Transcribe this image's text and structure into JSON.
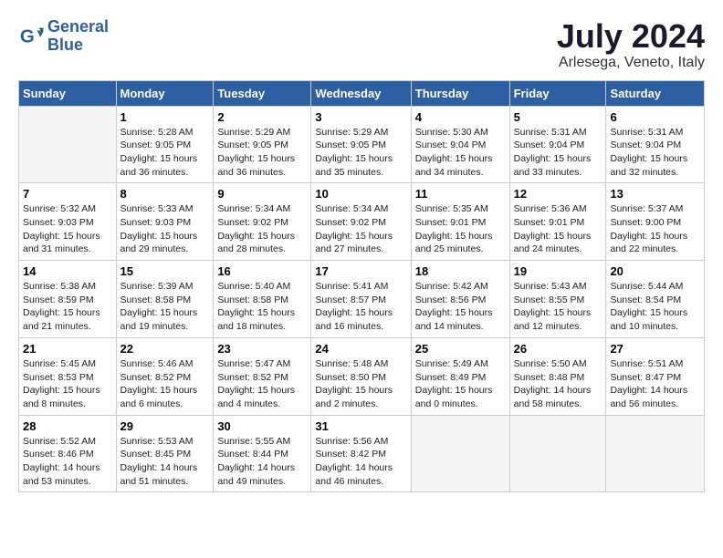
{
  "logo": {
    "text_general": "General",
    "text_blue": "Blue"
  },
  "title": "July 2024",
  "subtitle": "Arlesega, Veneto, Italy",
  "headers": [
    "Sunday",
    "Monday",
    "Tuesday",
    "Wednesday",
    "Thursday",
    "Friday",
    "Saturday"
  ],
  "weeks": [
    [
      {
        "day": "",
        "info": ""
      },
      {
        "day": "1",
        "info": "Sunrise: 5:28 AM\nSunset: 9:05 PM\nDaylight: 15 hours\nand 36 minutes."
      },
      {
        "day": "2",
        "info": "Sunrise: 5:29 AM\nSunset: 9:05 PM\nDaylight: 15 hours\nand 36 minutes."
      },
      {
        "day": "3",
        "info": "Sunrise: 5:29 AM\nSunset: 9:05 PM\nDaylight: 15 hours\nand 35 minutes."
      },
      {
        "day": "4",
        "info": "Sunrise: 5:30 AM\nSunset: 9:04 PM\nDaylight: 15 hours\nand 34 minutes."
      },
      {
        "day": "5",
        "info": "Sunrise: 5:31 AM\nSunset: 9:04 PM\nDaylight: 15 hours\nand 33 minutes."
      },
      {
        "day": "6",
        "info": "Sunrise: 5:31 AM\nSunset: 9:04 PM\nDaylight: 15 hours\nand 32 minutes."
      }
    ],
    [
      {
        "day": "7",
        "info": "Sunrise: 5:32 AM\nSunset: 9:03 PM\nDaylight: 15 hours\nand 31 minutes."
      },
      {
        "day": "8",
        "info": "Sunrise: 5:33 AM\nSunset: 9:03 PM\nDaylight: 15 hours\nand 29 minutes."
      },
      {
        "day": "9",
        "info": "Sunrise: 5:34 AM\nSunset: 9:02 PM\nDaylight: 15 hours\nand 28 minutes."
      },
      {
        "day": "10",
        "info": "Sunrise: 5:34 AM\nSunset: 9:02 PM\nDaylight: 15 hours\nand 27 minutes."
      },
      {
        "day": "11",
        "info": "Sunrise: 5:35 AM\nSunset: 9:01 PM\nDaylight: 15 hours\nand 25 minutes."
      },
      {
        "day": "12",
        "info": "Sunrise: 5:36 AM\nSunset: 9:01 PM\nDaylight: 15 hours\nand 24 minutes."
      },
      {
        "day": "13",
        "info": "Sunrise: 5:37 AM\nSunset: 9:00 PM\nDaylight: 15 hours\nand 22 minutes."
      }
    ],
    [
      {
        "day": "14",
        "info": "Sunrise: 5:38 AM\nSunset: 8:59 PM\nDaylight: 15 hours\nand 21 minutes."
      },
      {
        "day": "15",
        "info": "Sunrise: 5:39 AM\nSunset: 8:58 PM\nDaylight: 15 hours\nand 19 minutes."
      },
      {
        "day": "16",
        "info": "Sunrise: 5:40 AM\nSunset: 8:58 PM\nDaylight: 15 hours\nand 18 minutes."
      },
      {
        "day": "17",
        "info": "Sunrise: 5:41 AM\nSunset: 8:57 PM\nDaylight: 15 hours\nand 16 minutes."
      },
      {
        "day": "18",
        "info": "Sunrise: 5:42 AM\nSunset: 8:56 PM\nDaylight: 15 hours\nand 14 minutes."
      },
      {
        "day": "19",
        "info": "Sunrise: 5:43 AM\nSunset: 8:55 PM\nDaylight: 15 hours\nand 12 minutes."
      },
      {
        "day": "20",
        "info": "Sunrise: 5:44 AM\nSunset: 8:54 PM\nDaylight: 15 hours\nand 10 minutes."
      }
    ],
    [
      {
        "day": "21",
        "info": "Sunrise: 5:45 AM\nSunset: 8:53 PM\nDaylight: 15 hours\nand 8 minutes."
      },
      {
        "day": "22",
        "info": "Sunrise: 5:46 AM\nSunset: 8:52 PM\nDaylight: 15 hours\nand 6 minutes."
      },
      {
        "day": "23",
        "info": "Sunrise: 5:47 AM\nSunset: 8:52 PM\nDaylight: 15 hours\nand 4 minutes."
      },
      {
        "day": "24",
        "info": "Sunrise: 5:48 AM\nSunset: 8:50 PM\nDaylight: 15 hours\nand 2 minutes."
      },
      {
        "day": "25",
        "info": "Sunrise: 5:49 AM\nSunset: 8:49 PM\nDaylight: 15 hours\nand 0 minutes."
      },
      {
        "day": "26",
        "info": "Sunrise: 5:50 AM\nSunset: 8:48 PM\nDaylight: 14 hours\nand 58 minutes."
      },
      {
        "day": "27",
        "info": "Sunrise: 5:51 AM\nSunset: 8:47 PM\nDaylight: 14 hours\nand 56 minutes."
      }
    ],
    [
      {
        "day": "28",
        "info": "Sunrise: 5:52 AM\nSunset: 8:46 PM\nDaylight: 14 hours\nand 53 minutes."
      },
      {
        "day": "29",
        "info": "Sunrise: 5:53 AM\nSunset: 8:45 PM\nDaylight: 14 hours\nand 51 minutes."
      },
      {
        "day": "30",
        "info": "Sunrise: 5:55 AM\nSunset: 8:44 PM\nDaylight: 14 hours\nand 49 minutes."
      },
      {
        "day": "31",
        "info": "Sunrise: 5:56 AM\nSunset: 8:42 PM\nDaylight: 14 hours\nand 46 minutes."
      },
      {
        "day": "",
        "info": ""
      },
      {
        "day": "",
        "info": ""
      },
      {
        "day": "",
        "info": ""
      }
    ]
  ]
}
